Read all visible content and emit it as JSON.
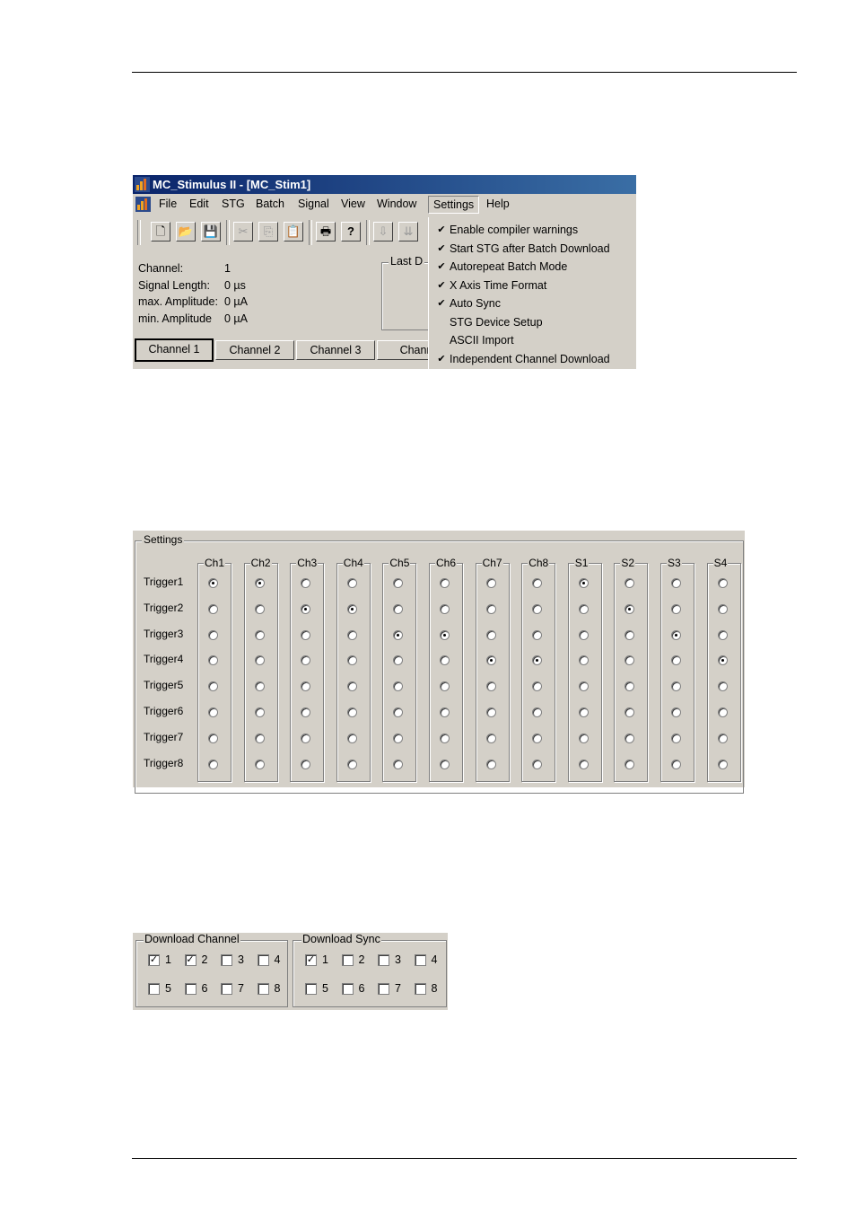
{
  "window": {
    "title": "MC_Stimulus II - [MC_Stim1]",
    "menu": [
      "File",
      "Edit",
      "STG",
      "Batch",
      "Signal",
      "View",
      "Window",
      "Settings",
      "Help"
    ],
    "open_menu": "Settings",
    "toolbar_icons": [
      "new-file-icon",
      "open-folder-icon",
      "save-icon",
      "cut-icon",
      "copy-icon",
      "paste-icon",
      "print-icon",
      "help-icon",
      "download-icon",
      "download-all-icon"
    ],
    "info": [
      {
        "label": "Channel:",
        "value": "1"
      },
      {
        "label": "Signal Length:",
        "value": "0 µs"
      },
      {
        "label": "max. Amplitude:",
        "value": "0 µA"
      },
      {
        "label": "min. Amplitude",
        "value": "0 µA"
      }
    ],
    "last_download_label": "Last D",
    "tabs": [
      "Channel 1",
      "Channel 2",
      "Channel 3",
      "Chann"
    ],
    "settings_menu": [
      {
        "label": "Enable compiler warnings",
        "checked": true
      },
      {
        "label": "Start STG after Batch Download",
        "checked": true
      },
      {
        "label": "Autorepeat Batch Mode",
        "checked": true
      },
      {
        "label": "X Axis Time Format",
        "checked": true
      },
      {
        "label": "Auto Sync",
        "checked": true
      },
      {
        "label": "STG Device Setup",
        "checked": false
      },
      {
        "label": "ASCII Import",
        "checked": false
      },
      {
        "label": "Independent Channel Download",
        "checked": true
      }
    ],
    "check_glyph": "✔"
  },
  "trigger_settings": {
    "group_label": "Settings",
    "columns": [
      "Ch1",
      "Ch2",
      "Ch3",
      "Ch4",
      "Ch5",
      "Ch6",
      "Ch7",
      "Ch8",
      "S1",
      "S2",
      "S3",
      "S4"
    ],
    "rows": [
      "Trigger1",
      "Trigger2",
      "Trigger3",
      "Trigger4",
      "Trigger5",
      "Trigger6",
      "Trigger7",
      "Trigger8"
    ],
    "selected_trigger_index": [
      0,
      0,
      1,
      1,
      2,
      2,
      3,
      3,
      0,
      1,
      2,
      3
    ]
  },
  "download": {
    "channel": {
      "label": "Download Channel",
      "items": [
        "1",
        "2",
        "3",
        "4",
        "5",
        "6",
        "7",
        "8"
      ],
      "checked": [
        true,
        true,
        false,
        false,
        false,
        false,
        false,
        false
      ]
    },
    "sync": {
      "label": "Download Sync",
      "items": [
        "1",
        "2",
        "3",
        "4",
        "5",
        "6",
        "7",
        "8"
      ],
      "checked": [
        true,
        false,
        false,
        false,
        false,
        false,
        false,
        false
      ]
    },
    "check_glyph": "✓"
  }
}
